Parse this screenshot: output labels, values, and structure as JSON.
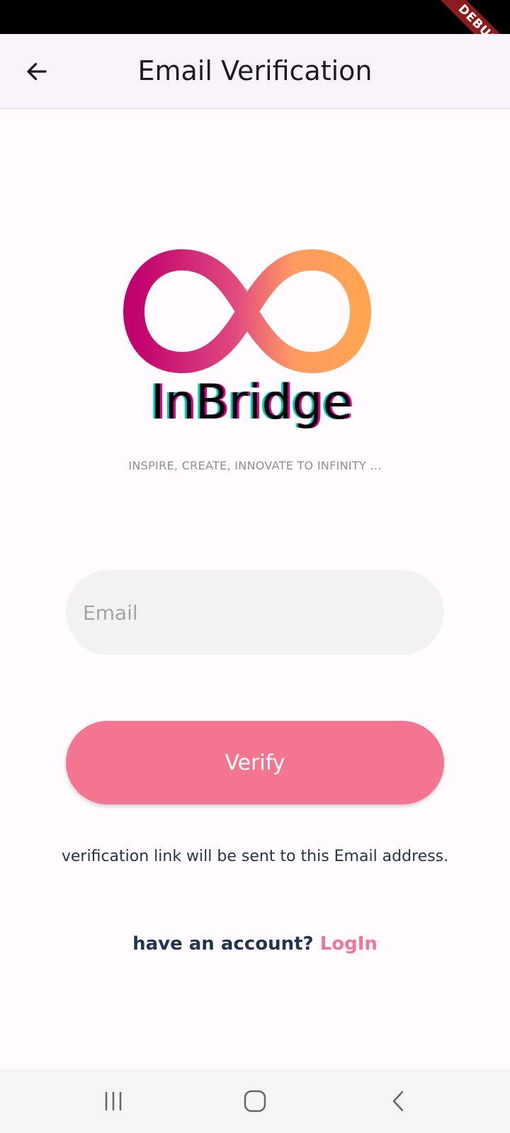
{
  "debug_banner": "DEBUG",
  "app_bar": {
    "title": "Email Verification",
    "back_icon": "arrow-back-icon"
  },
  "logo": {
    "mark_icon": "infinity-logo-icon",
    "wordmark": "InBridge",
    "tagline": "INSPIRE, CREATE, INNOVATE  TO INFINITY ..."
  },
  "form": {
    "email_placeholder": "Email",
    "email_value": "",
    "verify_label": "Verify",
    "note": "verification link will be sent to this Email address.",
    "account_prompt": "have an account?",
    "login_label": "LogIn"
  },
  "nav_bar": {
    "recents_icon": "recents-icon",
    "home_icon": "home-icon",
    "back_icon": "nav-back-icon"
  },
  "colors": {
    "accent": "#f4758f",
    "text_dark": "#1f3550",
    "logo_gradient_start": "#c0006e",
    "logo_gradient_end": "#ffa552"
  }
}
